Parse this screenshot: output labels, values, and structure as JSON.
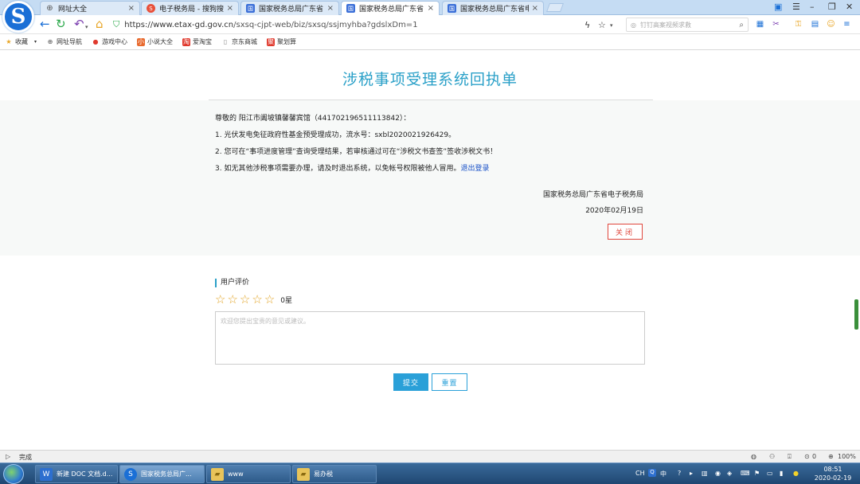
{
  "browser": {
    "tabs": [
      {
        "label": "网址大全",
        "icon": "globe-icon"
      },
      {
        "label": "电子税务局 - 搜狗搜索",
        "icon": "sogou-icon"
      },
      {
        "label": "国家税务总局广东省电子",
        "icon": "tax-site-icon"
      },
      {
        "label": "国家税务总局广东省电子",
        "icon": "tax-site-icon",
        "active": true
      },
      {
        "label": "国家税务总局广东省电子",
        "icon": "tax-site-icon"
      }
    ],
    "close_glyph": "×",
    "url_host": "https://www.etax-gd.gov.cn",
    "url_path": "/sxsq-cjpt-web/biz/sxsq/ssjmyhba?gdslxDm=1",
    "search_placeholder": "钉钉高案视频求救",
    "bookmarks": [
      {
        "label": "收藏",
        "icon": "star-icon"
      },
      {
        "label": "网址导航",
        "icon": "globe-icon"
      },
      {
        "label": "游戏中心",
        "icon": "game-icon"
      },
      {
        "label": "小说大全",
        "icon": "book-icon"
      },
      {
        "label": "爱淘宝",
        "icon": "taobao-icon"
      },
      {
        "label": "京东商城",
        "icon": "page-icon"
      },
      {
        "label": "聚划算",
        "icon": "juhuasuan-icon"
      }
    ],
    "status_text": "完成",
    "status_count": "0",
    "zoom": "100%"
  },
  "receipt": {
    "title": "涉税事项受理系统回执单",
    "greeting": "尊敬的 阳江市阖坡镇馨馨宾馆（441702196511113842）：",
    "line1": "1. 光伏发电免征政府性基金预受理成功，流水号：sxbl2020021926429。",
    "line2": "2. 您可在“事项进度管理”查询受理结果，若审核通过可在“涉税文书查签”签收涉税文书！",
    "line3": "3. 如无其他涉税事项需要办理，请及时退出系统，以免帐号权限被他人冒用。",
    "logout_link": "退出登录",
    "issuer": "国家税务总局广东省电子税务局",
    "date": "2020年02月19日",
    "close_button": "关闭"
  },
  "rating": {
    "heading": "用户评价",
    "stars_filled": 0,
    "stars_total": 5,
    "score_text": "0星",
    "placeholder": "欢迎您提出宝贵的意见或建议。",
    "submit_button": "提交",
    "reset_button": "重置"
  },
  "taskbar": {
    "tasks": [
      {
        "label": "新建 DOC 文档.d...",
        "icon": "word-icon"
      },
      {
        "label": "国家税务总局广...",
        "icon": "browser-icon",
        "active": true
      },
      {
        "label": "www",
        "icon": "folder-icon"
      },
      {
        "label": "易办税",
        "icon": "folder-icon"
      }
    ],
    "ime": "CH",
    "lang": "中",
    "time": "08:51",
    "date": "2020-02-19"
  },
  "colors": {
    "accent": "#2aa0c8",
    "close_red": "#e0473c",
    "star": "#e2a426"
  }
}
